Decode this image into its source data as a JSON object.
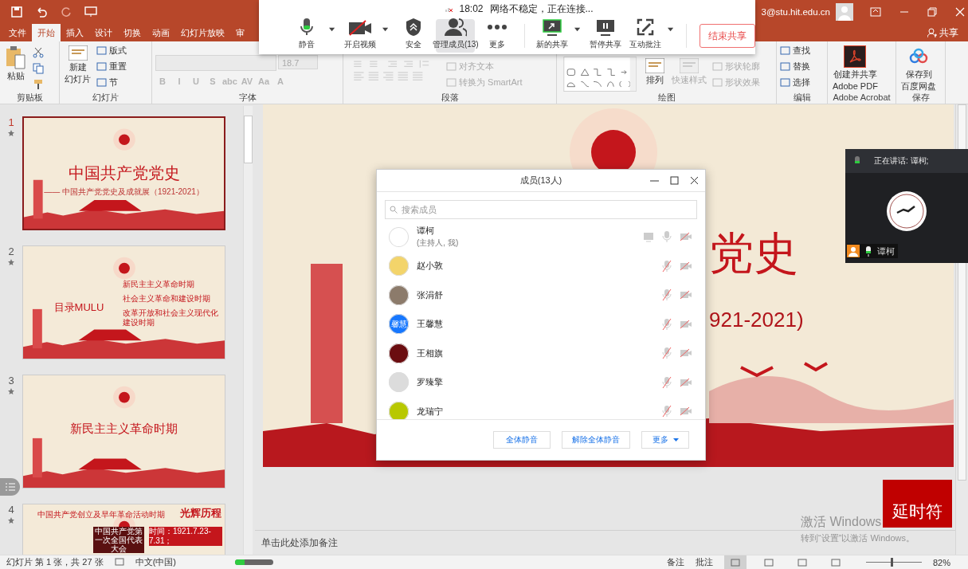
{
  "title_bar": {
    "account": "3@stu.hit.edu.cn"
  },
  "tabs": [
    {
      "label": "文件",
      "selected": false
    },
    {
      "label": "开始",
      "selected": true
    },
    {
      "label": "插入",
      "selected": false
    },
    {
      "label": "设计",
      "selected": false
    },
    {
      "label": "切换",
      "selected": false
    },
    {
      "label": "动画",
      "selected": false
    },
    {
      "label": "幻灯片放映",
      "selected": false
    },
    {
      "label": "审",
      "selected": false
    }
  ],
  "share_button": "共享",
  "ribbon": [
    {
      "kind": "clipboard",
      "label": "剪贴板",
      "items": [
        {
          "kind": "large",
          "lines": [
            "粘贴"
          ],
          "disabled": false
        }
      ]
    },
    {
      "kind": "slides",
      "label": "幻灯片",
      "items": [
        {
          "kind": "large",
          "lines": [
            "新建",
            "幻灯片"
          ],
          "disabled": false
        },
        {
          "kind": "small",
          "label": "版式",
          "disabled": false
        },
        {
          "kind": "small",
          "label": "重置",
          "disabled": false
        },
        {
          "kind": "small",
          "label": "节",
          "disabled": false
        }
      ]
    },
    {
      "kind": "font",
      "label": "字体",
      "items": [
        {
          "kind": "field",
          "label": "18.7",
          "disabled": true
        },
        {
          "kind": "glyph",
          "label": "B",
          "disabled": true
        },
        {
          "kind": "glyph",
          "label": "I",
          "disabled": true
        },
        {
          "kind": "glyph",
          "label": "U",
          "disabled": true
        },
        {
          "kind": "glyph",
          "label": "S",
          "disabled": true
        },
        {
          "kind": "glyph",
          "label": "abc",
          "disabled": true
        },
        {
          "kind": "glyph",
          "label": "AV",
          "disabled": true
        },
        {
          "kind": "glyph",
          "label": "Aa",
          "disabled": true
        },
        {
          "kind": "glyph",
          "label": "A",
          "disabled": true
        }
      ]
    },
    {
      "kind": "paragraph",
      "label": "段落",
      "items": [
        {
          "kind": "small",
          "label": "对齐文本",
          "disabled": true
        },
        {
          "kind": "small",
          "label": "转换为 SmartArt",
          "disabled": true
        }
      ]
    },
    {
      "kind": "drawing",
      "label": "绘图",
      "items": [
        {
          "kind": "large",
          "lines": [
            "排列"
          ],
          "disabled": false
        },
        {
          "kind": "large",
          "lines": [
            "快速样式"
          ],
          "disabled": true
        },
        {
          "kind": "small",
          "label": "形状轮廓",
          "disabled": true
        },
        {
          "kind": "small",
          "label": "形状效果",
          "disabled": true
        }
      ]
    },
    {
      "kind": "editing",
      "label": "编辑",
      "items": [
        {
          "kind": "small",
          "label": "查找",
          "disabled": false
        },
        {
          "kind": "small",
          "label": "替换",
          "disabled": false
        },
        {
          "kind": "small",
          "label": "选择",
          "disabled": false
        }
      ]
    },
    {
      "kind": "acrobat",
      "label": "Adobe Acrobat",
      "items": [
        {
          "kind": "large",
          "lines": [
            "创建并共享",
            "Adobe PDF"
          ],
          "disabled": false
        }
      ]
    },
    {
      "kind": "save",
      "label": "保存",
      "items": [
        {
          "kind": "large",
          "lines": [
            "保存到",
            "百度网盘"
          ],
          "disabled": false
        }
      ]
    }
  ],
  "slides": [
    {
      "number": "1",
      "selected": true,
      "kind": "title",
      "title": "中国共产党党史",
      "subtitle": "—— 中国共产党党史及成就展（1921-2021）"
    },
    {
      "number": "2",
      "selected": false,
      "kind": "toc",
      "title": "目录MULU",
      "items": [
        "新民主主义革命时期",
        "社会主义革命和建设时期",
        "改革开放和社会主义现代化建设时期"
      ]
    },
    {
      "number": "3",
      "selected": false,
      "kind": "section",
      "title": "新民主主义革命时期"
    },
    {
      "number": "4",
      "selected": false,
      "kind": "content",
      "title": "中国共产党创立及早年革命活动时期",
      "badge": "光辉历程",
      "card": "中国共产党第一次全国代表大会",
      "time": "时间：1921.7.23-7.31；"
    }
  ],
  "slide": {
    "title": "党史",
    "subtitle": "921-2021)"
  },
  "notes_placeholder": "单击此处添加备注",
  "meeting_toolbar": {
    "time": "18:02",
    "status": "网络不稳定，正在连接...",
    "buttons": [
      {
        "kind": "mic",
        "label": "静音",
        "dropdown": true,
        "selected": false
      },
      {
        "kind": "video",
        "label": "开启视频",
        "dropdown": true,
        "selected": false
      },
      {
        "kind": "shield",
        "label": "安全",
        "dropdown": false,
        "selected": false
      },
      {
        "kind": "members",
        "label": "管理成员(13)",
        "dropdown": false,
        "selected": true
      },
      {
        "kind": "more",
        "label": "更多",
        "dropdown": false,
        "selected": false
      },
      {
        "kind": "share",
        "label": "新的共享",
        "dropdown": true,
        "selected": false
      },
      {
        "kind": "pause",
        "label": "暂停共享",
        "dropdown": false,
        "selected": false
      },
      {
        "kind": "annotate",
        "label": "互动批注",
        "dropdown": true,
        "selected": false
      }
    ],
    "end_button": "结束共享"
  },
  "members_dialog": {
    "title": "成员(13人)",
    "search_placeholder": "搜索成员",
    "members": [
      {
        "name": "谭柯",
        "role": "(主持人, 我)",
        "color": "#ffffff",
        "mic_muted": false,
        "camera_off": true,
        "sharing": true
      },
      {
        "name": "赵小敦",
        "color": "#f3d46a",
        "mic_muted": true,
        "camera_off": true,
        "sharing": false
      },
      {
        "name": "张涓舒",
        "color": "#8c7b6b",
        "mic_muted": true,
        "camera_off": true,
        "sharing": false
      },
      {
        "name": "王馨慧",
        "color": "#1677ff",
        "avatar_text": "馨慧",
        "mic_muted": true,
        "camera_off": true,
        "sharing": false
      },
      {
        "name": "王相旗",
        "color": "#6b0d10",
        "mic_muted": true,
        "camera_off": true,
        "sharing": false
      },
      {
        "name": "罗臻擎",
        "color": "#dcdcdc",
        "mic_muted": true,
        "camera_off": true,
        "sharing": false
      },
      {
        "name": "龙瑞宁",
        "color": "#b8c800",
        "mic_muted": true,
        "camera_off": true,
        "sharing": false
      }
    ],
    "buttons": [
      "全体静音",
      "解除全体静音"
    ],
    "more_button": "更多"
  },
  "video_panel": {
    "speaking": "正在讲话: 谭柯;",
    "name": "谭柯"
  },
  "badge": "延时符",
  "activation": {
    "title": "激活 Windows",
    "hint": "转到“设置”以激活 Windows。"
  },
  "status_bar": {
    "slide_info": "幻灯片 第 1 张，共 27 张",
    "language": "中文(中国)",
    "progress": {
      "level": 0.25
    },
    "notes": "备注",
    "comments": "批注",
    "views": [
      {
        "selected": true
      },
      {
        "selected": false
      },
      {
        "selected": false
      },
      {
        "selected": false
      }
    ],
    "zoom_slider": {
      "level": 0.45
    },
    "zoom": "82%"
  }
}
